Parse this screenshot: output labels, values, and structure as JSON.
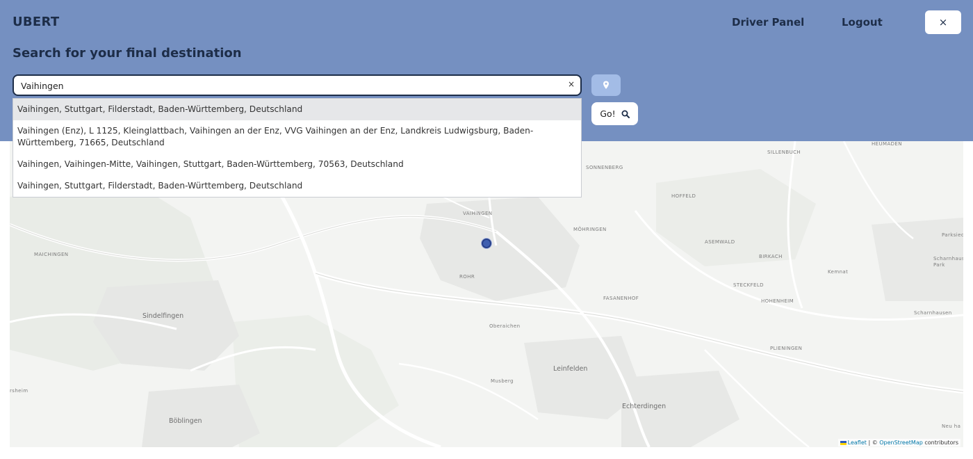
{
  "header": {
    "brand": "UBERT",
    "nav": {
      "driver_panel": "Driver Panel",
      "logout": "Logout"
    },
    "close_symbol": "×",
    "heading": "Search for your final destination"
  },
  "search": {
    "value": "Vaihingen",
    "clear_symbol": "×",
    "go_label": "Go!",
    "suggestions": [
      "Vaihingen, Stuttgart, Filderstadt, Baden-Württemberg, Deutschland",
      "Vaihingen (Enz), L 1125, Kleinglattbach, Vaihingen an der Enz, VVG Vaihingen an der Enz, Landkreis Ludwigsburg, Baden-Württemberg, 71665, Deutschland",
      "Vaihingen, Vaihingen-Mitte, Vaihingen, Stuttgart, Baden-Württemberg, 70563, Deutschland",
      "Vaihingen, Stuttgart, Filderstadt, Baden-Württemberg, Deutschland"
    ]
  },
  "icons": {
    "location": "map-pin-icon",
    "search": "magnifier-icon",
    "close": "close-icon"
  },
  "map": {
    "places": {
      "sillenbuch": "SILLENBUCH",
      "heumaden": "HEUMADEN",
      "sonnenberg": "SONNENBERG",
      "hoffeld": "HOFFELD",
      "vaihingen": "VAIHINGEN",
      "mohringen": "MÖHRINGEN",
      "parksied": "Parksied",
      "asemwald": "ASEMWALD",
      "maichingen": "MAICHINGEN",
      "birkach": "BIRKACH",
      "schamhausen_park": "Scharnhaus Park",
      "kemnat": "Kemnat",
      "rohr": "ROHR",
      "steckfeld": "STECKFELD",
      "fasanenhof": "FASANENHOF",
      "hohenheim": "HOHENHEIM",
      "sindelfingen": "Sindelfingen",
      "oberaichen": "Oberaichen",
      "scharnhausen": "Scharnhausen",
      "plieningen": "PLIENINGEN",
      "leinfelden": "Leinfelden",
      "musberg": "Musberg",
      "ersheim": "rsheim",
      "echterdingen": "Echterdingen",
      "boblingen": "Böblingen",
      "neuhausen": "Neu ha"
    },
    "attribution": {
      "leaflet": "Leaflet",
      "separator": " | © ",
      "osm": "OpenStreetMap",
      "contributors": " contributors"
    }
  }
}
